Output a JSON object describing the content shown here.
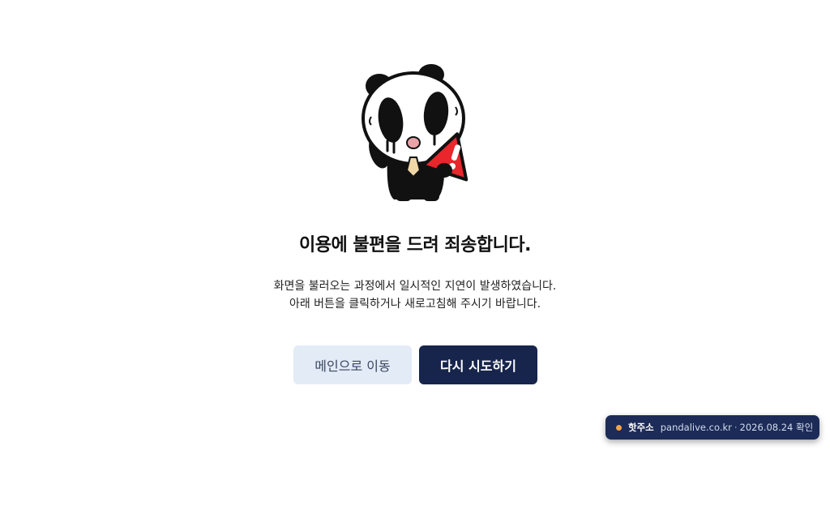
{
  "error": {
    "title": "이용에 불편을 드려 죄송합니다.",
    "message_line1": "화면을 불러오는 과정에서 일시적인 지연이 발생하였습니다.",
    "message_line2": "아래 버튼을 클릭하거나 새로고침해 주시기 바랍니다."
  },
  "buttons": {
    "main_label": "메인으로 이동",
    "retry_label": "다시 시도하기"
  },
  "toast": {
    "name": "핫주소",
    "domain": "pandalive.co.kr",
    "separator": "·",
    "checked": "2026.08.24 확인"
  },
  "mascot": {
    "icon": "panda-warning-icon"
  },
  "colors": {
    "primary_button": "#17254d",
    "secondary_button": "#e3ebf7",
    "toast_bg": "#1c2b57",
    "toast_dot": "#f5a34a",
    "warning": "#e8262c"
  }
}
